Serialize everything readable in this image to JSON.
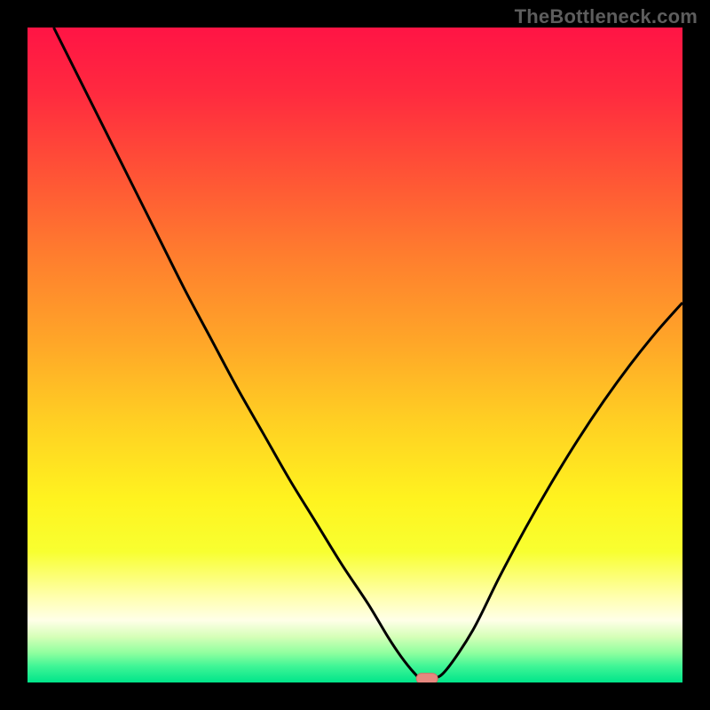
{
  "source_label": "TheBottleneck.com",
  "colors": {
    "gradient_stops": [
      {
        "offset": 0.0,
        "color": "#ff1445"
      },
      {
        "offset": 0.1,
        "color": "#ff2a3f"
      },
      {
        "offset": 0.22,
        "color": "#ff5236"
      },
      {
        "offset": 0.35,
        "color": "#ff7e2e"
      },
      {
        "offset": 0.48,
        "color": "#ffa628"
      },
      {
        "offset": 0.6,
        "color": "#ffcf23"
      },
      {
        "offset": 0.72,
        "color": "#fff31f"
      },
      {
        "offset": 0.8,
        "color": "#f8ff30"
      },
      {
        "offset": 0.87,
        "color": "#ffffb0"
      },
      {
        "offset": 0.905,
        "color": "#ffffe8"
      },
      {
        "offset": 0.93,
        "color": "#d6ffb8"
      },
      {
        "offset": 0.955,
        "color": "#8fff9f"
      },
      {
        "offset": 0.975,
        "color": "#40f596"
      },
      {
        "offset": 1.0,
        "color": "#00e58a"
      }
    ],
    "curve": "#000000",
    "marker_fill": "#e6887f",
    "marker_stroke": "#d07068"
  },
  "chart_data": {
    "type": "line",
    "title": "",
    "xlabel": "",
    "ylabel": "",
    "xlim": [
      0,
      100
    ],
    "ylim": [
      0,
      100
    ],
    "grid": false,
    "legend": false,
    "series": [
      {
        "name": "bottleneck-curve",
        "x": [
          4,
          8,
          12,
          16,
          20,
          24,
          28,
          32,
          36,
          40,
          44,
          48,
          52,
          55,
          57,
          59,
          60,
          62,
          64,
          68,
          72,
          76,
          80,
          84,
          88,
          92,
          96,
          100
        ],
        "y": [
          100,
          92,
          84,
          76,
          68,
          60,
          52.5,
          45,
          38,
          31,
          24.5,
          18,
          12,
          7,
          4,
          1.5,
          0.7,
          0.6,
          2,
          8,
          16,
          23.5,
          30.5,
          37,
          43,
          48.5,
          53.5,
          58
        ]
      }
    ],
    "marker": {
      "x": 61,
      "y": 0.6
    }
  }
}
